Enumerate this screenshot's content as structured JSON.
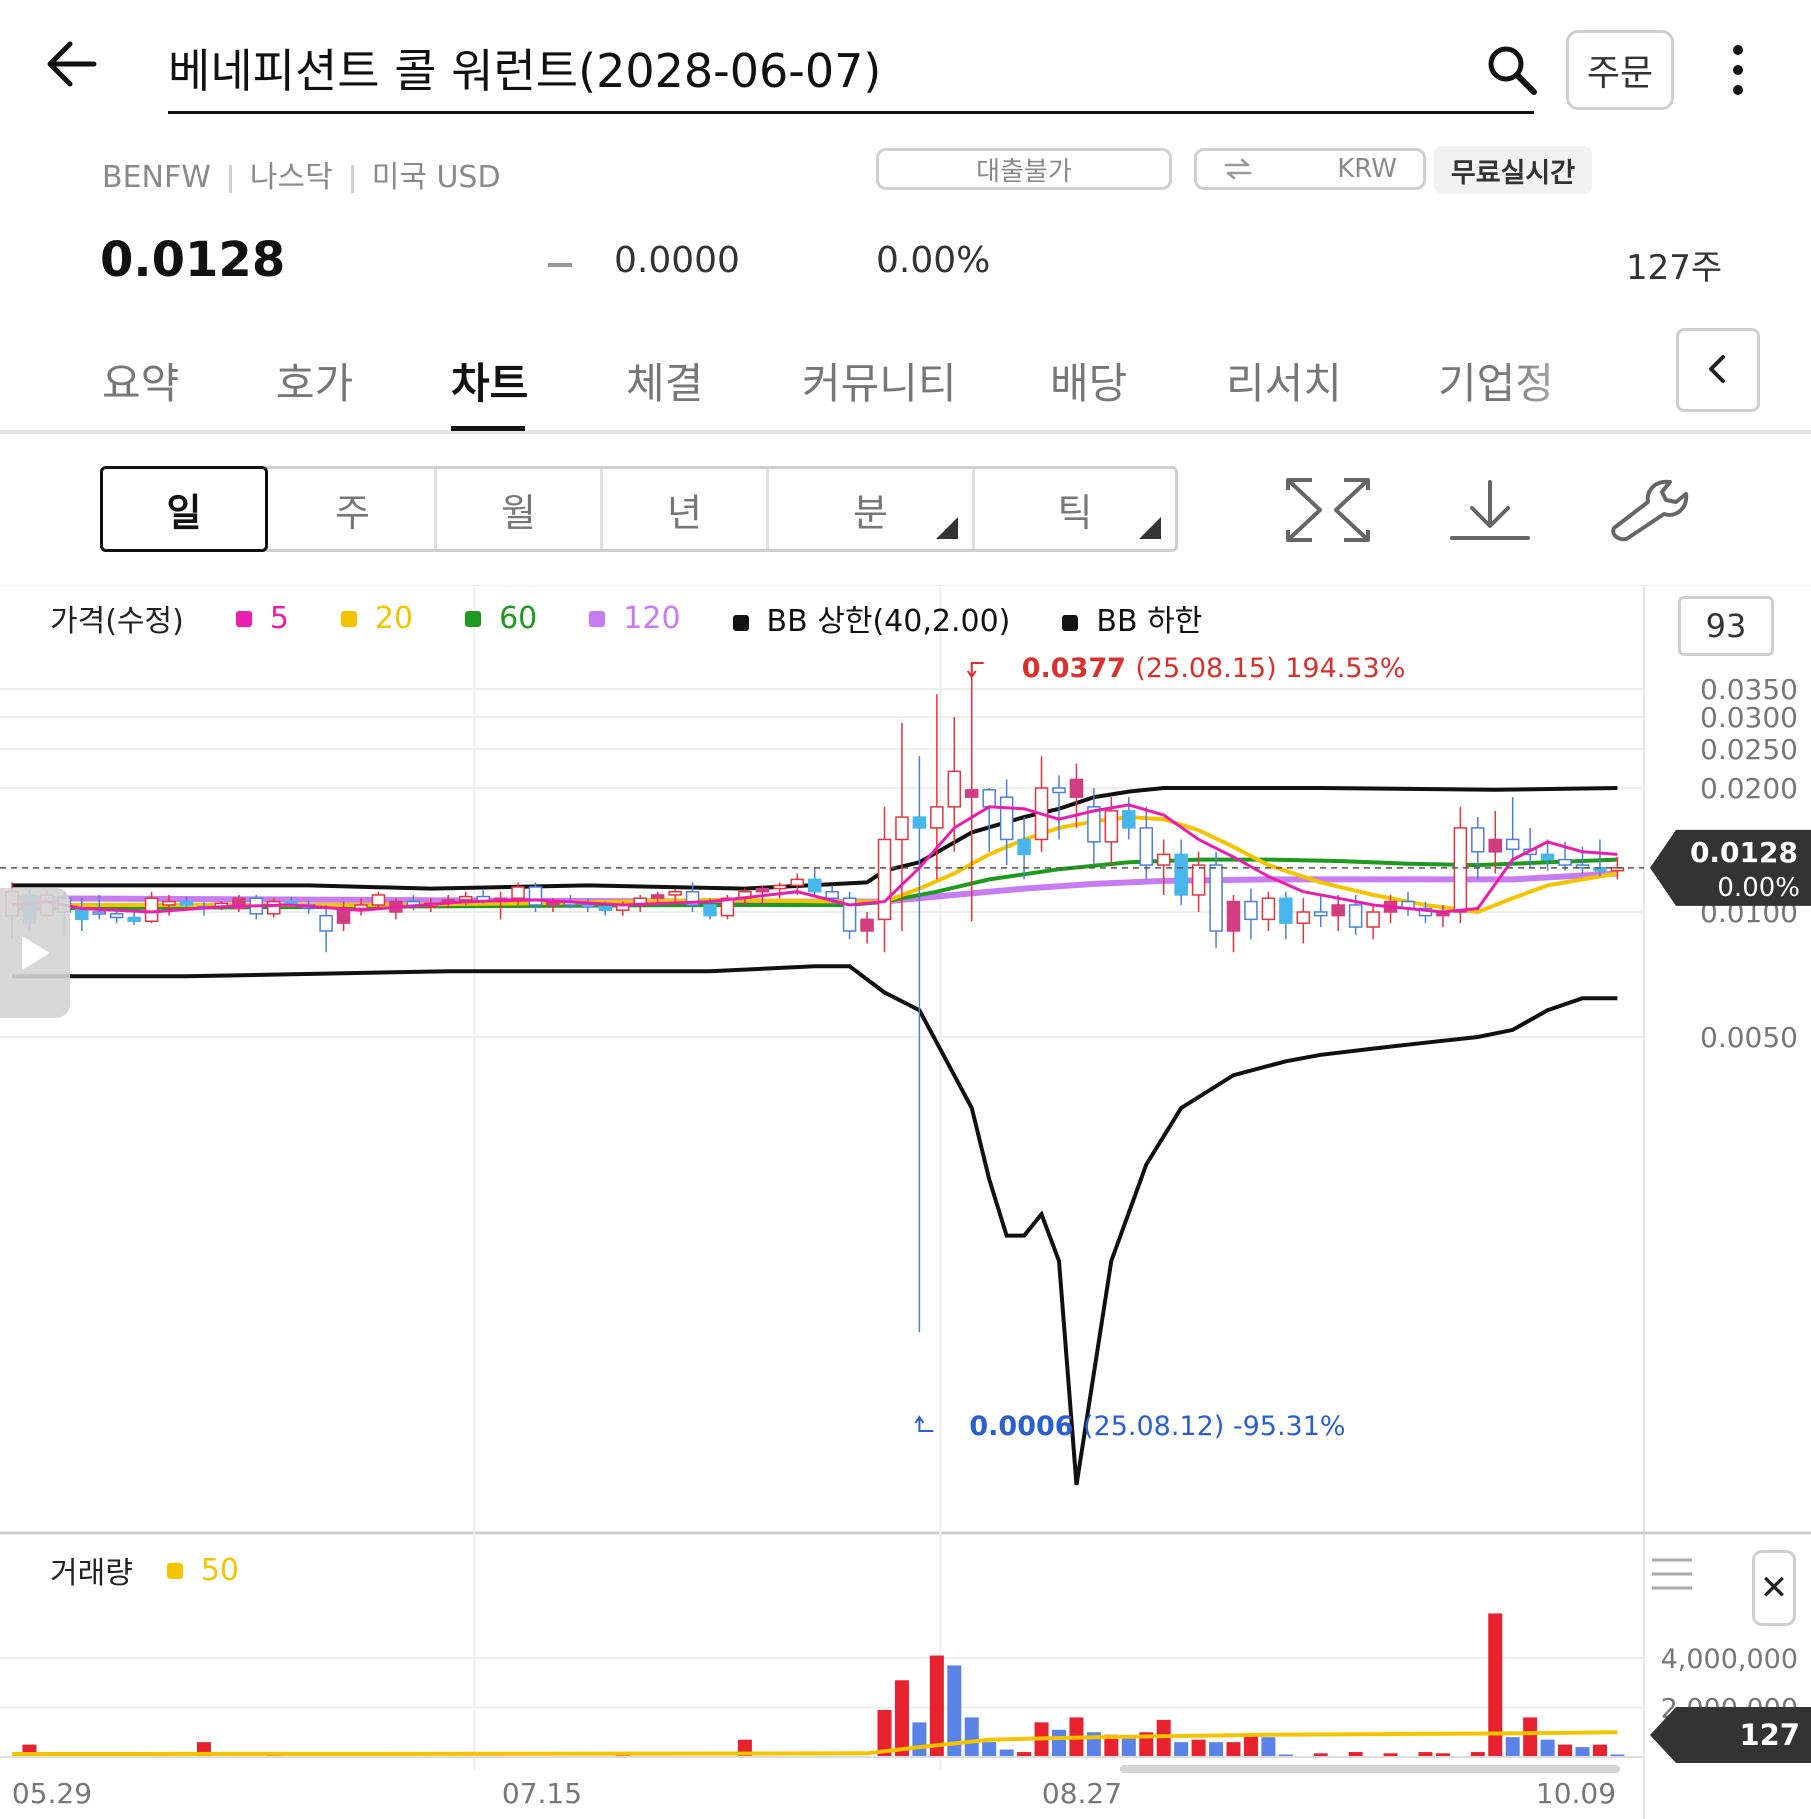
{
  "header": {
    "title": "베네피션트 콜 워런트(2028-06-07)",
    "order_label": "주문",
    "icons": {
      "back": "arrow-left-icon",
      "search": "search-icon",
      "more": "more-vertical-icon"
    }
  },
  "meta": {
    "ticker": "BENFW",
    "exchange": "나스닥",
    "currency": "미국 USD",
    "loan": "대출불가",
    "fx_label": "KRW",
    "realtime": "무료실시간"
  },
  "quote": {
    "price": "0.0128",
    "change": "0.0000",
    "change_pct": "0.00%",
    "volume": "127주"
  },
  "tabs": [
    "요약",
    "호가",
    "차트",
    "체결",
    "커뮤니티",
    "배당",
    "리서치",
    "기업정"
  ],
  "active_tab": "차트",
  "periods": [
    "일",
    "주",
    "월",
    "년",
    "분",
    "틱"
  ],
  "active_period": "일",
  "indicator_count": "93",
  "colors": {
    "up": "#e8323c",
    "down": "#4a7fe0",
    "up_fill": "#d23c80",
    "down_fill": "#47b6ea",
    "ma5": "#e91eae",
    "ma20": "#f5c400",
    "ma60": "#1e9a1e",
    "ma120": "#c77cf2",
    "bb": "#111111",
    "high_label": "#d9302c",
    "low_label": "#2b5fd0"
  },
  "chart_data": {
    "type": "candlestick",
    "price_legend": {
      "title": "가격(수정)",
      "items": [
        {
          "label": "5",
          "color": "#e91eae"
        },
        {
          "label": "20",
          "color": "#f5c400"
        },
        {
          "label": "60",
          "color": "#1e9a1e"
        },
        {
          "label": "120",
          "color": "#c77cf2"
        },
        {
          "label": "BB 상한(40,2.00)",
          "color": "#111111"
        },
        {
          "label": "BB 하한",
          "color": "#111111"
        }
      ]
    },
    "y_ticks": [
      "0.0350",
      "0.0300",
      "0.0250",
      "0.0200",
      "0.0100",
      "0.0050"
    ],
    "y_tick_values": [
      0.035,
      0.03,
      0.025,
      0.02,
      0.01,
      0.005
    ],
    "x_ticks": [
      "05.29",
      "07.15",
      "08.27",
      "10.09"
    ],
    "current": {
      "price": "0.0128",
      "pct": "0.00%"
    },
    "high_marker": {
      "value": "0.0377",
      "detail": "(25.08.15) 194.53%"
    },
    "low_marker": {
      "value": "0.0006",
      "detail": "(25.08.12) -95.31%"
    },
    "candles": [
      [
        0.0098,
        0.0118,
        0.0086,
        0.0112
      ],
      [
        0.011,
        0.0113,
        0.009,
        0.0094
      ],
      [
        0.0098,
        0.0112,
        0.0096,
        0.011
      ],
      [
        0.0108,
        0.0112,
        0.0088,
        0.01
      ],
      [
        0.0102,
        0.0108,
        0.009,
        0.0096
      ],
      [
        0.01,
        0.011,
        0.0096,
        0.0099
      ],
      [
        0.0099,
        0.0102,
        0.0094,
        0.0097
      ],
      [
        0.0097,
        0.01,
        0.0093,
        0.0095
      ],
      [
        0.0095,
        0.0112,
        0.0094,
        0.0108
      ],
      [
        0.0104,
        0.011,
        0.0098,
        0.0106
      ],
      [
        0.0106,
        0.0109,
        0.0103,
        0.0104
      ],
      [
        0.0103,
        0.0106,
        0.0098,
        0.0102
      ],
      [
        0.0103,
        0.0106,
        0.0101,
        0.0105
      ],
      [
        0.0102,
        0.011,
        0.01,
        0.0108
      ],
      [
        0.0108,
        0.011,
        0.0096,
        0.0099
      ],
      [
        0.0099,
        0.0108,
        0.0097,
        0.0106
      ],
      [
        0.0106,
        0.0109,
        0.0103,
        0.0104
      ],
      [
        0.0104,
        0.0107,
        0.0099,
        0.0102
      ],
      [
        0.0098,
        0.0104,
        0.008,
        0.009
      ],
      [
        0.0094,
        0.0106,
        0.009,
        0.0102
      ],
      [
        0.0102,
        0.0108,
        0.0098,
        0.0104
      ],
      [
        0.0104,
        0.0112,
        0.0102,
        0.011
      ],
      [
        0.01,
        0.0108,
        0.0096,
        0.0106
      ],
      [
        0.0106,
        0.011,
        0.0101,
        0.0103
      ],
      [
        0.0103,
        0.0108,
        0.01,
        0.0105
      ],
      [
        0.0105,
        0.011,
        0.0102,
        0.0107
      ],
      [
        0.0107,
        0.0112,
        0.0104,
        0.0109
      ],
      [
        0.0109,
        0.0113,
        0.0105,
        0.0106
      ],
      [
        0.0106,
        0.0112,
        0.0096,
        0.0108
      ],
      [
        0.0108,
        0.0118,
        0.0104,
        0.0115
      ],
      [
        0.0115,
        0.0118,
        0.01,
        0.0104
      ],
      [
        0.0104,
        0.0108,
        0.01,
        0.0106
      ],
      [
        0.0106,
        0.011,
        0.0102,
        0.0104
      ],
      [
        0.0104,
        0.0108,
        0.01,
        0.0103
      ],
      [
        0.0103,
        0.0106,
        0.0098,
        0.0101
      ],
      [
        0.0101,
        0.0106,
        0.0098,
        0.0104
      ],
      [
        0.0104,
        0.011,
        0.01,
        0.0108
      ],
      [
        0.0108,
        0.0112,
        0.0104,
        0.011
      ],
      [
        0.011,
        0.0114,
        0.0106,
        0.0112
      ],
      [
        0.0112,
        0.0118,
        0.01,
        0.0104
      ],
      [
        0.0104,
        0.0108,
        0.0096,
        0.0098
      ],
      [
        0.0098,
        0.011,
        0.0096,
        0.0108
      ],
      [
        0.0108,
        0.0114,
        0.0104,
        0.0112
      ],
      [
        0.0112,
        0.0116,
        0.0104,
        0.0114
      ],
      [
        0.0114,
        0.0118,
        0.0108,
        0.0116
      ],
      [
        0.0116,
        0.0124,
        0.011,
        0.012
      ],
      [
        0.012,
        0.0128,
        0.011,
        0.0112
      ],
      [
        0.0112,
        0.0116,
        0.0104,
        0.0108
      ],
      [
        0.0108,
        0.0112,
        0.0086,
        0.009
      ],
      [
        0.009,
        0.01,
        0.0084,
        0.0096
      ],
      [
        0.0096,
        0.018,
        0.008,
        0.015
      ],
      [
        0.015,
        0.029,
        0.009,
        0.017
      ],
      [
        0.017,
        0.024,
        0.0006,
        0.016
      ],
      [
        0.016,
        0.034,
        0.012,
        0.018
      ],
      [
        0.018,
        0.03,
        0.014,
        0.022
      ],
      [
        0.019,
        0.0377,
        0.0095,
        0.0198
      ],
      [
        0.0198,
        0.02,
        0.014,
        0.018
      ],
      [
        0.019,
        0.021,
        0.013,
        0.015
      ],
      [
        0.015,
        0.017,
        0.012,
        0.0138
      ],
      [
        0.015,
        0.024,
        0.014,
        0.02
      ],
      [
        0.02,
        0.0215,
        0.015,
        0.0195
      ],
      [
        0.019,
        0.023,
        0.016,
        0.021
      ],
      [
        0.018,
        0.02,
        0.013,
        0.0148
      ],
      [
        0.0148,
        0.019,
        0.013,
        0.0176
      ],
      [
        0.0176,
        0.019,
        0.015,
        0.016
      ],
      [
        0.016,
        0.018,
        0.012,
        0.013
      ],
      [
        0.013,
        0.015,
        0.011,
        0.0138
      ],
      [
        0.0138,
        0.015,
        0.0104,
        0.011
      ],
      [
        0.011,
        0.014,
        0.01,
        0.013
      ],
      [
        0.013,
        0.014,
        0.0082,
        0.009
      ],
      [
        0.009,
        0.011,
        0.008,
        0.0106
      ],
      [
        0.0106,
        0.0114,
        0.0086,
        0.0096
      ],
      [
        0.0096,
        0.0112,
        0.009,
        0.0108
      ],
      [
        0.0108,
        0.0112,
        0.0086,
        0.0094
      ],
      [
        0.0094,
        0.0108,
        0.0084,
        0.01
      ],
      [
        0.01,
        0.011,
        0.0092,
        0.0098
      ],
      [
        0.0098,
        0.011,
        0.009,
        0.0104
      ],
      [
        0.0104,
        0.011,
        0.0088,
        0.0092
      ],
      [
        0.0092,
        0.0104,
        0.0086,
        0.01
      ],
      [
        0.01,
        0.011,
        0.0094,
        0.0106
      ],
      [
        0.0106,
        0.0112,
        0.0098,
        0.0102
      ],
      [
        0.0102,
        0.0106,
        0.0094,
        0.0098
      ],
      [
        0.0098,
        0.0104,
        0.0092,
        0.01
      ],
      [
        0.01,
        0.018,
        0.0094,
        0.016
      ],
      [
        0.016,
        0.017,
        0.012,
        0.014
      ],
      [
        0.014,
        0.0176,
        0.0124,
        0.015
      ],
      [
        0.015,
        0.019,
        0.013,
        0.0142
      ],
      [
        0.0142,
        0.016,
        0.0128,
        0.0138
      ],
      [
        0.0138,
        0.015,
        0.0126,
        0.0134
      ],
      [
        0.0134,
        0.0148,
        0.0126,
        0.013
      ],
      [
        0.013,
        0.0144,
        0.0124,
        0.0128
      ],
      [
        0.0128,
        0.015,
        0.0122,
        0.0126
      ],
      [
        0.0126,
        0.0136,
        0.012,
        0.0128
      ]
    ],
    "bb_upper": [
      [
        0,
        0.0116
      ],
      [
        8,
        0.0116
      ],
      [
        17,
        0.0116
      ],
      [
        24,
        0.0114
      ],
      [
        33,
        0.0116
      ],
      [
        42,
        0.0114
      ],
      [
        49,
        0.0118
      ],
      [
        50,
        0.0126
      ],
      [
        52,
        0.0132
      ],
      [
        55,
        0.0156
      ],
      [
        58,
        0.017
      ],
      [
        60,
        0.0178
      ],
      [
        62,
        0.019
      ],
      [
        64,
        0.0196
      ],
      [
        66,
        0.02
      ],
      [
        75,
        0.02
      ],
      [
        85,
        0.0198
      ],
      [
        92,
        0.02
      ]
    ],
    "bb_lower": [
      [
        0,
        0.007
      ],
      [
        10,
        0.007
      ],
      [
        25,
        0.0072
      ],
      [
        40,
        0.0072
      ],
      [
        46,
        0.0074
      ],
      [
        48,
        0.0074
      ],
      [
        50,
        0.0064
      ],
      [
        52,
        0.0058
      ],
      [
        53,
        0.0048
      ],
      [
        55,
        0.003
      ],
      [
        56,
        0.0018
      ],
      [
        57,
        0.0012
      ],
      [
        58,
        0.0012
      ],
      [
        59,
        0.0014
      ],
      [
        60,
        0.001
      ],
      [
        61,
        0.0002
      ],
      [
        63,
        0.001
      ],
      [
        65,
        0.002
      ],
      [
        67,
        0.003
      ],
      [
        70,
        0.0038
      ],
      [
        73,
        0.0042
      ],
      [
        75,
        0.0044
      ],
      [
        78,
        0.0046
      ],
      [
        81,
        0.0048
      ],
      [
        84,
        0.005
      ],
      [
        86,
        0.0052
      ],
      [
        88,
        0.0058
      ],
      [
        90,
        0.0062
      ],
      [
        92,
        0.0062
      ]
    ],
    "ma5": [
      [
        0,
        0.0104
      ],
      [
        2,
        0.0106
      ],
      [
        4,
        0.0102
      ],
      [
        8,
        0.01
      ],
      [
        12,
        0.0103
      ],
      [
        16,
        0.0104
      ],
      [
        20,
        0.0101
      ],
      [
        26,
        0.0106
      ],
      [
        30,
        0.0107
      ],
      [
        35,
        0.0104
      ],
      [
        40,
        0.0106
      ],
      [
        45,
        0.0112
      ],
      [
        48,
        0.0104
      ],
      [
        50,
        0.0106
      ],
      [
        52,
        0.0128
      ],
      [
        54,
        0.016
      ],
      [
        56,
        0.018
      ],
      [
        58,
        0.0178
      ],
      [
        60,
        0.0168
      ],
      [
        62,
        0.0176
      ],
      [
        64,
        0.0182
      ],
      [
        66,
        0.0172
      ],
      [
        68,
        0.015
      ],
      [
        70,
        0.0136
      ],
      [
        72,
        0.0122
      ],
      [
        74,
        0.0112
      ],
      [
        76,
        0.0108
      ],
      [
        78,
        0.0104
      ],
      [
        80,
        0.0102
      ],
      [
        82,
        0.01
      ],
      [
        84,
        0.0102
      ],
      [
        86,
        0.0134
      ],
      [
        88,
        0.0148
      ],
      [
        90,
        0.014
      ],
      [
        92,
        0.0138
      ]
    ],
    "ma20": [
      [
        0,
        0.0104
      ],
      [
        10,
        0.0104
      ],
      [
        20,
        0.0104
      ],
      [
        30,
        0.0105
      ],
      [
        40,
        0.0107
      ],
      [
        48,
        0.0106
      ],
      [
        50,
        0.0106
      ],
      [
        52,
        0.0114
      ],
      [
        54,
        0.0124
      ],
      [
        56,
        0.0138
      ],
      [
        58,
        0.015
      ],
      [
        60,
        0.016
      ],
      [
        62,
        0.0166
      ],
      [
        64,
        0.017
      ],
      [
        66,
        0.0168
      ],
      [
        68,
        0.0158
      ],
      [
        70,
        0.0144
      ],
      [
        72,
        0.013
      ],
      [
        75,
        0.0118
      ],
      [
        78,
        0.011
      ],
      [
        81,
        0.0104
      ],
      [
        84,
        0.01
      ],
      [
        86,
        0.0108
      ],
      [
        88,
        0.0116
      ],
      [
        90,
        0.012
      ],
      [
        92,
        0.0124
      ]
    ],
    "ma60": [
      [
        0,
        0.0102
      ],
      [
        20,
        0.0103
      ],
      [
        40,
        0.0104
      ],
      [
        48,
        0.0104
      ],
      [
        50,
        0.0106
      ],
      [
        53,
        0.0112
      ],
      [
        56,
        0.012
      ],
      [
        60,
        0.0127
      ],
      [
        64,
        0.0132
      ],
      [
        68,
        0.0134
      ],
      [
        72,
        0.0134
      ],
      [
        76,
        0.0133
      ],
      [
        80,
        0.0131
      ],
      [
        84,
        0.013
      ],
      [
        88,
        0.0132
      ],
      [
        92,
        0.0134
      ]
    ],
    "ma120": [
      [
        0,
        0.0108
      ],
      [
        20,
        0.0107
      ],
      [
        40,
        0.0106
      ],
      [
        48,
        0.0106
      ],
      [
        50,
        0.0106
      ],
      [
        54,
        0.011
      ],
      [
        58,
        0.0114
      ],
      [
        62,
        0.0117
      ],
      [
        66,
        0.0119
      ],
      [
        72,
        0.012
      ],
      [
        80,
        0.012
      ],
      [
        86,
        0.012
      ],
      [
        92,
        0.0124
      ]
    ],
    "volume": {
      "title": "거래량",
      "ma_label": "50",
      "y_ticks": [
        "4,000,000",
        "2,000,000"
      ],
      "y_tick_values": [
        4000000,
        2000000
      ],
      "current": "127",
      "bars": [
        [
          1,
          500000,
          "up"
        ],
        [
          3,
          100000,
          "up"
        ],
        [
          11,
          600000,
          "up"
        ],
        [
          15,
          120000,
          "up"
        ],
        [
          35,
          150000,
          "up"
        ],
        [
          42,
          700000,
          "up"
        ],
        [
          50,
          1900000,
          "up"
        ],
        [
          51,
          3100000,
          "up"
        ],
        [
          52,
          1400000,
          "down"
        ],
        [
          53,
          4100000,
          "up"
        ],
        [
          54,
          3700000,
          "down"
        ],
        [
          55,
          1600000,
          "down"
        ],
        [
          56,
          600000,
          "down"
        ],
        [
          57,
          300000,
          "down"
        ],
        [
          58,
          200000,
          "up"
        ],
        [
          59,
          1400000,
          "up"
        ],
        [
          60,
          1100000,
          "down"
        ],
        [
          61,
          1600000,
          "up"
        ],
        [
          62,
          1000000,
          "down"
        ],
        [
          63,
          900000,
          "up"
        ],
        [
          64,
          800000,
          "down"
        ],
        [
          65,
          1000000,
          "up"
        ],
        [
          66,
          1500000,
          "up"
        ],
        [
          67,
          600000,
          "down"
        ],
        [
          68,
          700000,
          "up"
        ],
        [
          69,
          600000,
          "down"
        ],
        [
          70,
          600000,
          "up"
        ],
        [
          71,
          900000,
          "up"
        ],
        [
          72,
          800000,
          "down"
        ],
        [
          73,
          100000,
          "down"
        ],
        [
          75,
          150000,
          "up"
        ],
        [
          77,
          200000,
          "up"
        ],
        [
          79,
          150000,
          "up"
        ],
        [
          81,
          200000,
          "up"
        ],
        [
          82,
          150000,
          "up"
        ],
        [
          84,
          200000,
          "up"
        ],
        [
          85,
          5800000,
          "up"
        ],
        [
          86,
          800000,
          "down"
        ],
        [
          87,
          1600000,
          "up"
        ],
        [
          88,
          700000,
          "down"
        ],
        [
          89,
          500000,
          "up"
        ],
        [
          90,
          400000,
          "down"
        ],
        [
          91,
          500000,
          "up"
        ],
        [
          92,
          100000,
          "down"
        ]
      ],
      "ma50": [
        [
          0,
          120000
        ],
        [
          30,
          130000
        ],
        [
          49,
          150000
        ],
        [
          52,
          400000
        ],
        [
          56,
          700000
        ],
        [
          62,
          800000
        ],
        [
          72,
          900000
        ],
        [
          85,
          950000
        ],
        [
          92,
          1000000
        ]
      ]
    }
  }
}
